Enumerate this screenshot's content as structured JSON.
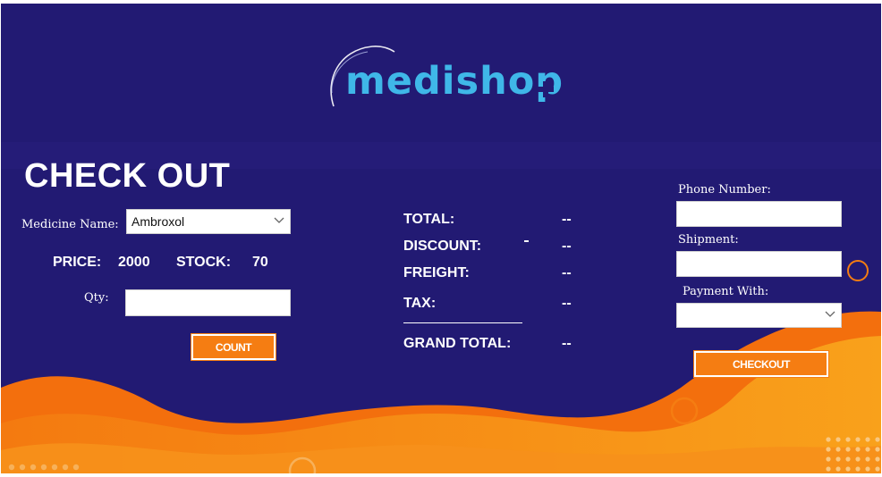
{
  "logo": {
    "text": "medishop"
  },
  "page_title": "CHECK OUT",
  "order": {
    "medicine_label": "Medicine Name:",
    "medicine_value": "Ambroxol",
    "price_label": "PRICE:",
    "price_value": "2000",
    "stock_label": "STOCK:",
    "stock_value": "70",
    "qty_label": "Qty:",
    "qty_value": "",
    "count_button": "COUNT"
  },
  "summary": {
    "total_label": "TOTAL:",
    "total_value": "--",
    "discount_label": "DISCOUNT:",
    "discount_value": "--",
    "freight_label": "FREIGHT:",
    "freight_value": "--",
    "tax_label": "TAX:",
    "tax_value": "--",
    "grand_total_label": "GRAND TOTAL:",
    "grand_total_value": "--"
  },
  "customer": {
    "phone_label": "Phone Number:",
    "phone_value": "",
    "shipment_label": "Shipment:",
    "shipment_value": "",
    "payment_label": "Payment With:",
    "payment_value": "",
    "checkout_button": "CHECKOUT"
  },
  "colors": {
    "background": "#221a73",
    "accent_orange": "#f57d12",
    "logo_blue": "#3fb7e8"
  },
  "icons": [
    "chevron-down-icon",
    "logo-plus-icon"
  ]
}
